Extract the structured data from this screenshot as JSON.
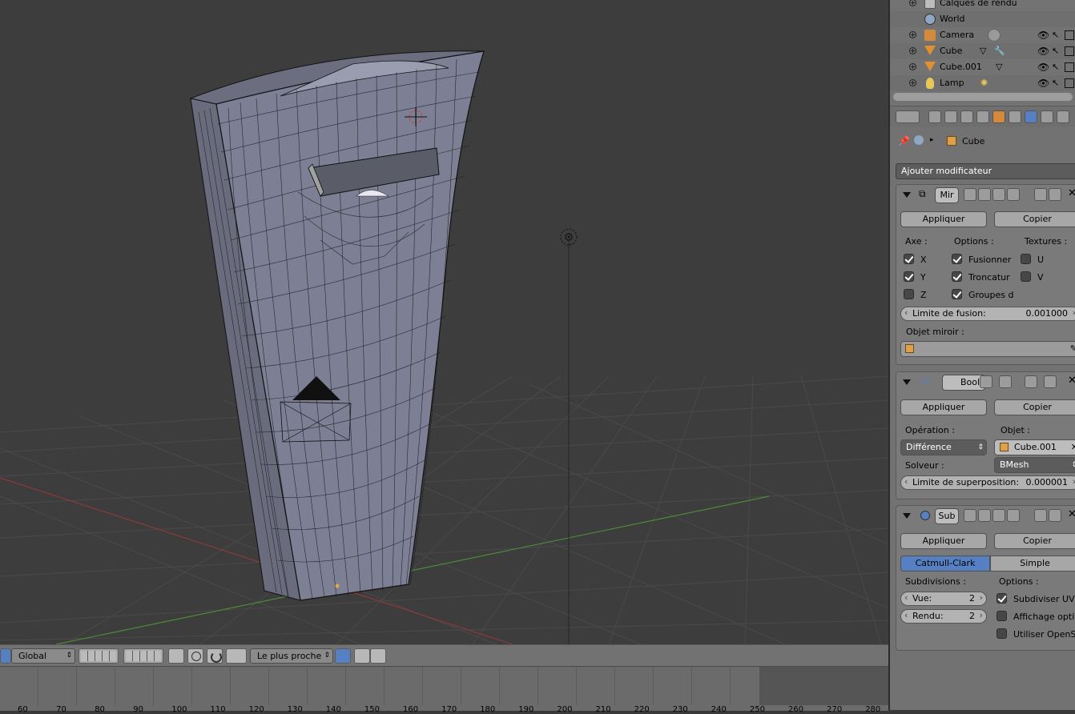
{
  "outliner": {
    "rows": [
      {
        "name": "Calques de rendu",
        "icon": "render-layers-icon"
      },
      {
        "name": "World",
        "icon": "world-icon"
      },
      {
        "name": "Camera",
        "icon": "camera-object-icon"
      },
      {
        "name": "Cube",
        "icon": "mesh-object-icon"
      },
      {
        "name": "Cube.001",
        "icon": "mesh-object-icon"
      },
      {
        "name": "Lamp",
        "icon": "lamp-object-icon"
      }
    ]
  },
  "properties": {
    "breadcrumb_object": "Cube",
    "add_modifier": "Ajouter modificateur",
    "mirror": {
      "name": "Mir",
      "apply": "Appliquer",
      "copy": "Copier",
      "axis_label": "Axe :",
      "options_label": "Options :",
      "textures_label": "Textures :",
      "x": "X",
      "y": "Y",
      "z": "Z",
      "merge": "Fusionner",
      "clipping": "Troncatur",
      "vertex_groups": "Groupes d",
      "u": "U",
      "v": "V",
      "merge_limit_label": "Limite de fusion:",
      "merge_limit_value": "0.001000",
      "mirror_object_label": "Objet miroir :"
    },
    "boolean": {
      "name": "Boole",
      "apply": "Appliquer",
      "copy": "Copier",
      "operation_label": "Opération :",
      "object_label": "Objet :",
      "operation_value": "Différence",
      "object_value": "Cube.001",
      "solver_label": "Solveur :",
      "solver_value": "BMesh",
      "overlap_label": "Limite de superposition:",
      "overlap_value": "0.000001"
    },
    "subsurf": {
      "name": "Sub",
      "apply": "Appliquer",
      "copy": "Copier",
      "catmull": "Catmull-Clark",
      "simple": "Simple",
      "subdivisions_label": "Subdivisions :",
      "options_label": "Options :",
      "view_label": "Vue:",
      "view_value": "2",
      "render_label": "Rendu:",
      "render_value": "2",
      "opt1": "Subdiviser UVs",
      "opt2": "Affichage opti...",
      "opt3": "Utiliser OpenS..."
    }
  },
  "viewport_header": {
    "orientation": "Global",
    "snap": "Le plus proche"
  },
  "timeline": {
    "ticks": [
      "60",
      "70",
      "80",
      "90",
      "100",
      "110",
      "120",
      "130",
      "140",
      "150",
      "160",
      "170",
      "180",
      "190",
      "200",
      "210",
      "220",
      "230",
      "240",
      "250",
      "260",
      "270",
      "280"
    ]
  },
  "colors": {
    "viewport_bg": "#3d3d3d",
    "mesh_fill": "#7d7f94",
    "x_axis": "#8a3a3a",
    "y_axis": "#4c8a3a",
    "active_button": "#5680c2"
  }
}
